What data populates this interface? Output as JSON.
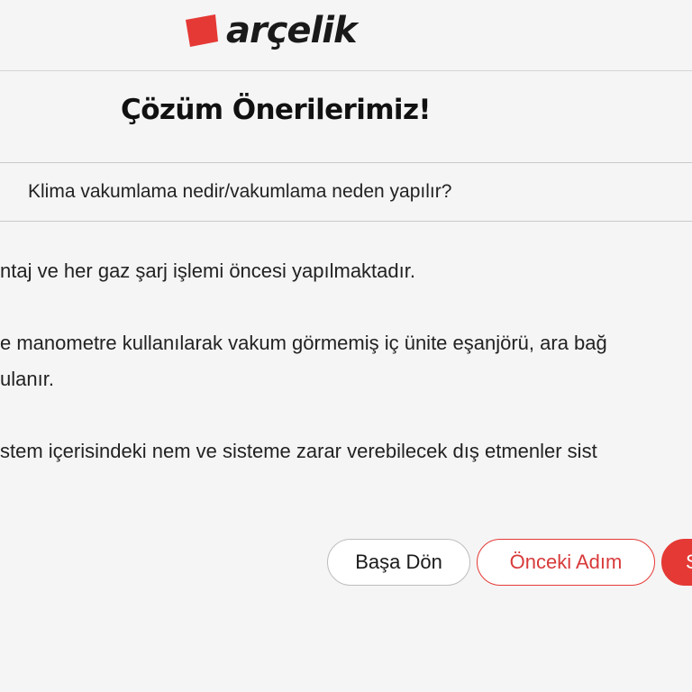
{
  "brand": {
    "name": "arçelik",
    "accent_color": "#e53935"
  },
  "page": {
    "title": "Çözüm Önerilerimiz!"
  },
  "question": {
    "text": "Klima vakumlama nedir/vakumlama neden yapılır?"
  },
  "answer": {
    "lines": [
      "ntaj ve her gaz şarj işlemi öncesi yapılmaktadır.",
      "e manometre kullanılarak vakum görmemiş iç ünite eşanjörü, ara bağ",
      "ulanır.",
      "stem içerisindeki nem ve sisteme zarar verebilecek dış etmenler sist"
    ]
  },
  "actions": {
    "home_label": "Başa Dön",
    "prev_label": "Önceki Adım",
    "next_label": "S"
  }
}
